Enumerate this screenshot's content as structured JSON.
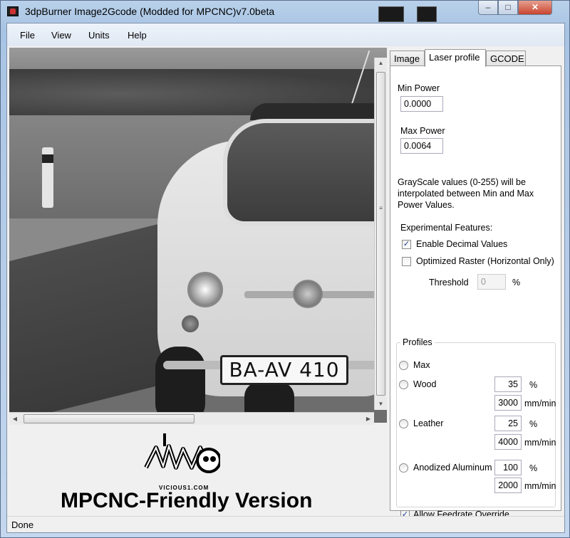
{
  "window": {
    "title": "3dpBurner Image2Gcode (Modded for MPCNC)v7.0beta",
    "buttons": {
      "minimize": "–",
      "maximize": "□",
      "close": "✕"
    }
  },
  "menu": {
    "items": [
      "File",
      "View",
      "Units",
      "Help"
    ]
  },
  "image": {
    "plate_text": "BA-AV 410"
  },
  "logo": {
    "graffiti_text": "VICIOUS",
    "sub_text": "VICIOUS1.COM",
    "title": "MPCNC-Friendly Version"
  },
  "status": {
    "text": "Done"
  },
  "tabs": [
    {
      "label": "Image",
      "active": false
    },
    {
      "label": "Laser profile",
      "active": true
    },
    {
      "label": "GCODE",
      "active": false
    }
  ],
  "laser": {
    "min_power_label": "Min Power",
    "min_power_value": "0.0000",
    "max_power_label": "Max Power",
    "max_power_value": "0.0064",
    "grayscale_note_line1": "GrayScale values (0-255) will be",
    "grayscale_note_line2": "interpolated between Min and Max",
    "grayscale_note_line3": "Power Values.",
    "experimental_label": "Experimental Features:",
    "enable_decimal_label": "Enable Decimal Values",
    "enable_decimal_checked": true,
    "optimized_raster_label": "Optimized Raster (Horizontal Only)",
    "optimized_raster_checked": false,
    "threshold_label": "Threshold",
    "threshold_value": "0",
    "threshold_unit": "%"
  },
  "profiles": {
    "title": "Profiles",
    "items": [
      {
        "label": "Max"
      },
      {
        "label": "Wood",
        "power": "35",
        "power_unit": "%",
        "speed": "3000",
        "speed_unit": "mm/min"
      },
      {
        "label": "Leather",
        "power": "25",
        "power_unit": "%",
        "speed": "4000",
        "speed_unit": "mm/min"
      },
      {
        "label": "Anodized Aluminum",
        "power": "100",
        "power_unit": "%",
        "speed": "2000",
        "speed_unit": "mm/min"
      }
    ],
    "allow_feedrate_label": "Allow Feedrate Override",
    "allow_feedrate_checked": true
  },
  "icons": {
    "checkmark": "✓",
    "scroll_up": "▲",
    "scroll_down": "▼",
    "scroll_left": "◀",
    "scroll_right": "▶",
    "grip": "≡"
  }
}
